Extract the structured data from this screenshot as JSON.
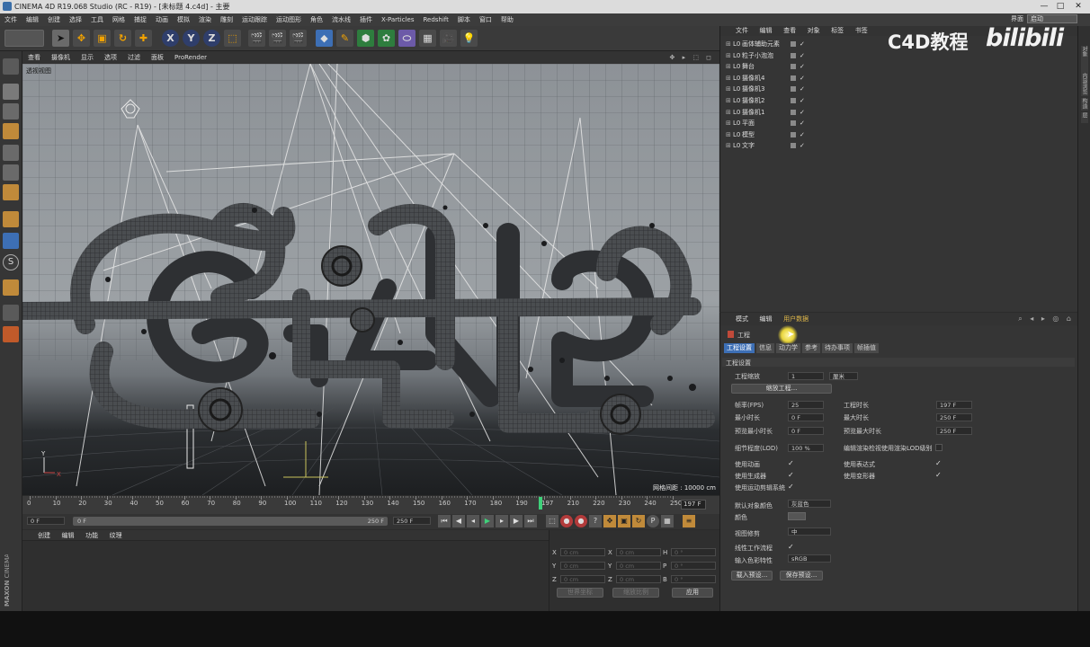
{
  "window": {
    "title": "CINEMA 4D R19.068 Studio (RC - R19) - [未标题 4.c4d] - 主要",
    "minimize": "—",
    "maximize": "□",
    "close": "✕"
  },
  "menu": [
    "文件",
    "编辑",
    "创建",
    "选择",
    "工具",
    "网格",
    "捕捉",
    "动画",
    "模拟",
    "渲染",
    "雕刻",
    "运动跟踪",
    "运动图形",
    "角色",
    "流水线",
    "插件",
    "X-Particles",
    "Redshift",
    "脚本",
    "窗口",
    "帮助"
  ],
  "layout": {
    "label": "界面",
    "value": "启动"
  },
  "toolbar": {
    "x": "X",
    "y": "Y",
    "z": "Z"
  },
  "viewport": {
    "menu": [
      "查看",
      "摄像机",
      "显示",
      "选项",
      "过滤",
      "面板",
      "ProRender"
    ],
    "label": "透视视图",
    "grid_info": "网格间距 : 10000 cm"
  },
  "timeline": {
    "ticks": [
      "0",
      "10",
      "20",
      "30",
      "40",
      "50",
      "60",
      "70",
      "80",
      "90",
      "100",
      "110",
      "120",
      "130",
      "140",
      "150",
      "160",
      "170",
      "180",
      "190",
      "197",
      "210",
      "220",
      "230",
      "240",
      "250"
    ],
    "current_frame": "197 F",
    "start": "0 F",
    "start2": "0 F",
    "end": "250 F",
    "end2": "250 F"
  },
  "material_panel": {
    "tabs": [
      "创建",
      "编辑",
      "功能",
      "纹理"
    ]
  },
  "coords": {
    "rows": [
      {
        "a": "X",
        "av": "0 cm",
        "b": "X",
        "bv": "0 cm",
        "c": "H",
        "cv": "0 °"
      },
      {
        "a": "Y",
        "av": "0 cm",
        "b": "Y",
        "bv": "0 cm",
        "c": "P",
        "cv": "0 °"
      },
      {
        "a": "Z",
        "av": "0 cm",
        "b": "Z",
        "bv": "0 cm",
        "c": "B",
        "cv": "0 °"
      }
    ],
    "sel1": "世界坐标",
    "sel2": "缩放比例",
    "apply": "应用"
  },
  "object_manager": {
    "tabs": [
      "文件",
      "编辑",
      "查看",
      "对象",
      "标签",
      "书签"
    ],
    "objects": [
      {
        "name": "画体辅助元素"
      },
      {
        "name": "粒子小泡泡"
      },
      {
        "name": "舞台"
      },
      {
        "name": "摄像机4"
      },
      {
        "name": "摄像机3"
      },
      {
        "name": "摄像机2"
      },
      {
        "name": "摄像机1"
      },
      {
        "name": "平面"
      },
      {
        "name": "模型"
      },
      {
        "name": "文字"
      }
    ]
  },
  "watermark": {
    "text": "C4D教程",
    "logo": "bilibili"
  },
  "attributes": {
    "tabs": [
      "模式",
      "编辑",
      "用户数据"
    ],
    "object_name": "工程",
    "subtabs": [
      "工程设置",
      "信息",
      "动力学",
      "参考",
      "待办事项",
      "帧插值"
    ],
    "section": "工程设置",
    "project_scale_label": "工程缩放",
    "project_scale": "1",
    "project_scale_unit": "厘米",
    "scale_button": "缩放工程...",
    "fps_label": "帧率(FPS)",
    "fps": "25",
    "project_time_label": "工程时长",
    "project_time": "197 F",
    "min_time_label": "最小时长",
    "min_time": "0 F",
    "max_time_label": "最大时长",
    "max_time": "250 F",
    "preview_min_label": "预览最小时长",
    "preview_min": "0 F",
    "preview_max_label": "预览最大时长",
    "preview_max": "250 F",
    "lod_label": "细节程度(LOD)",
    "lod": "100 %",
    "render_lod_label": "编辑渲染检视使用渲染LOD级别",
    "use_anim": "使用动画",
    "use_expr": "使用表达式",
    "use_gen": "使用生成器",
    "use_deform": "使用变形器",
    "use_motion": "使用运动剪辑系统",
    "default_color_label": "默认对象颜色",
    "default_color": "灰蓝色",
    "color_label": "颜色",
    "view_clip_label": "视图修剪",
    "view_clip": "中",
    "linear_label": "线性工作流程",
    "input_color_label": "输入色彩特性",
    "input_color": "sRGB",
    "load_preset": "载入预设...",
    "save_preset": "保存预设..."
  },
  "right_strip": [
    "对象",
    "内容浏览器",
    "构造",
    "层"
  ],
  "brand": {
    "maxon": "MAXON",
    "product": "CINEMA 4D"
  }
}
